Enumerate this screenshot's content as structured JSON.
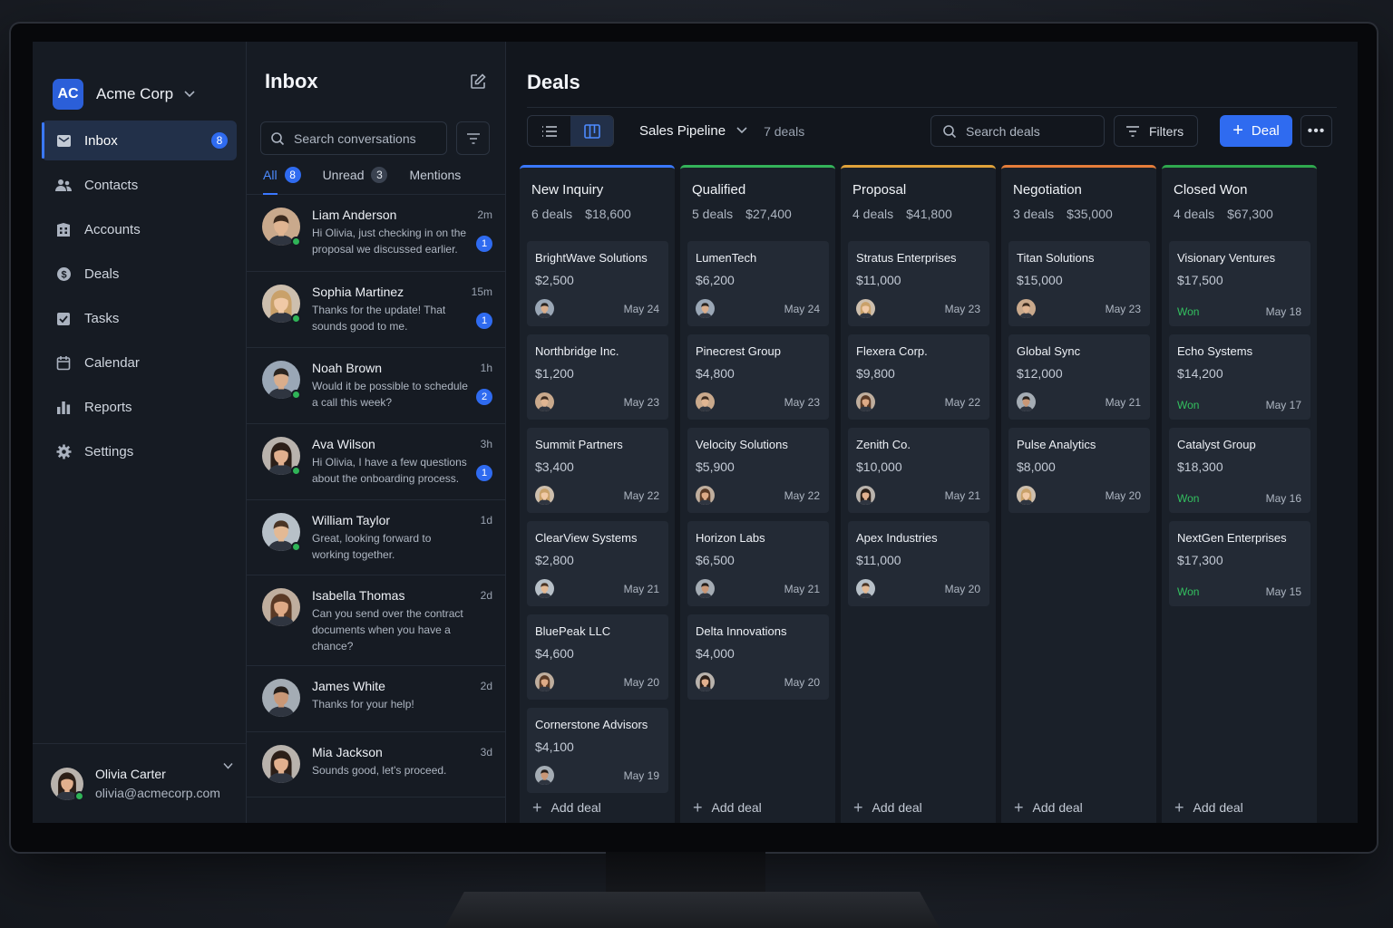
{
  "org": {
    "initials": "AC",
    "name": "Acme Corp"
  },
  "nav": [
    {
      "label": "Inbox",
      "icon": "inbox-icon",
      "badge": "8",
      "active": true
    },
    {
      "label": "Contacts",
      "icon": "contacts-icon"
    },
    {
      "label": "Accounts",
      "icon": "accounts-icon"
    },
    {
      "label": "Deals",
      "icon": "deals-icon"
    },
    {
      "label": "Tasks",
      "icon": "tasks-icon"
    },
    {
      "label": "Calendar",
      "icon": "calendar-icon"
    },
    {
      "label": "Reports",
      "icon": "reports-icon"
    },
    {
      "label": "Settings",
      "icon": "settings-icon"
    }
  ],
  "user": {
    "name": "Olivia Carter",
    "email": "olivia@acmecorp.com"
  },
  "inbox": {
    "title": "Inbox",
    "search_placeholder": "Search conversations",
    "tabs": [
      {
        "label": "All",
        "count": "8",
        "active": true
      },
      {
        "label": "Unread",
        "count": "3"
      },
      {
        "label": "Mentions",
        "count": ""
      }
    ],
    "conversations": [
      {
        "name": "Liam Anderson",
        "time": "2m",
        "message": "Hi Olivia, just checking in on the proposal we discussed earlier.",
        "unread": "1",
        "online": true,
        "avatar": "m1"
      },
      {
        "name": "Sophia Martinez",
        "time": "15m",
        "message": "Thanks for the update! That sounds good to me.",
        "unread": "1",
        "online": true,
        "avatar": "f1"
      },
      {
        "name": "Noah Brown",
        "time": "1h",
        "message": "Would it be possible to schedule a call this week?",
        "unread": "2",
        "online": true,
        "avatar": "m2"
      },
      {
        "name": "Ava Wilson",
        "time": "3h",
        "message": "Hi Olivia, I have a few questions about the onboarding process.",
        "unread": "1",
        "online": true,
        "avatar": "f2"
      },
      {
        "name": "William Taylor",
        "time": "1d",
        "message": "Great, looking forward to working together.",
        "unread": "",
        "online": true,
        "avatar": "m3"
      },
      {
        "name": "Isabella Thomas",
        "time": "2d",
        "message": "Can you send over the contract documents when you have a chance?",
        "unread": "",
        "online": false,
        "avatar": "f3"
      },
      {
        "name": "James White",
        "time": "2d",
        "message": "Thanks for your help!",
        "unread": "",
        "online": false,
        "avatar": "m4"
      },
      {
        "name": "Mia Jackson",
        "time": "3d",
        "message": "Sounds good, let's proceed.",
        "unread": "",
        "online": false,
        "avatar": "f2"
      }
    ]
  },
  "deals": {
    "title": "Deals",
    "pipeline": "Sales Pipeline",
    "deal_count": "7 deals",
    "search_placeholder": "Search deals",
    "filters_label": "Filters",
    "new_label": "Deal",
    "add_label": "Add deal",
    "columns": [
      {
        "name": "New Inquiry",
        "count": "6 deals",
        "total": "$18,600",
        "color": "#3a78ff",
        "cards": [
          {
            "name": "BrightWave Solutions",
            "value": "$2,500",
            "date": "May 24",
            "avatar": "m2"
          },
          {
            "name": "Northbridge Inc.",
            "value": "$1,200",
            "date": "May 23",
            "avatar": "m1"
          },
          {
            "name": "Summit Partners",
            "value": "$3,400",
            "date": "May 22",
            "avatar": "f1"
          },
          {
            "name": "ClearView Systems",
            "value": "$2,800",
            "date": "May 21",
            "avatar": "m3"
          },
          {
            "name": "BluePeak LLC",
            "value": "$4,600",
            "date": "May 20",
            "avatar": "f3"
          },
          {
            "name": "Cornerstone Advisors",
            "value": "$4,100",
            "date": "May 19",
            "avatar": "m4"
          }
        ]
      },
      {
        "name": "Qualified",
        "count": "5 deals",
        "total": "$27,400",
        "color": "#34b35a",
        "cards": [
          {
            "name": "LumenTech",
            "value": "$6,200",
            "date": "May 24",
            "avatar": "m2"
          },
          {
            "name": "Pinecrest Group",
            "value": "$4,800",
            "date": "May 23",
            "avatar": "m1"
          },
          {
            "name": "Velocity Solutions",
            "value": "$5,900",
            "date": "May 22",
            "avatar": "f3"
          },
          {
            "name": "Horizon Labs",
            "value": "$6,500",
            "date": "May 21",
            "avatar": "m4"
          },
          {
            "name": "Delta Innovations",
            "value": "$4,000",
            "date": "May 20",
            "avatar": "f2"
          }
        ]
      },
      {
        "name": "Proposal",
        "count": "4 deals",
        "total": "$41,800",
        "color": "#e0a23a",
        "cards": [
          {
            "name": "Stratus Enterprises",
            "value": "$11,000",
            "date": "May 23",
            "avatar": "f1"
          },
          {
            "name": "Flexera Corp.",
            "value": "$9,800",
            "date": "May 22",
            "avatar": "f3"
          },
          {
            "name": "Zenith Co.",
            "value": "$10,000",
            "date": "May 21",
            "avatar": "f2"
          },
          {
            "name": "Apex Industries",
            "value": "$11,000",
            "date": "May 20",
            "avatar": "m3"
          }
        ]
      },
      {
        "name": "Negotiation",
        "count": "3 deals",
        "total": "$35,000",
        "color": "#e57d3a",
        "cards": [
          {
            "name": "Titan Solutions",
            "value": "$15,000",
            "date": "May 23",
            "avatar": "m1"
          },
          {
            "name": "Global Sync",
            "value": "$12,000",
            "date": "May 21",
            "avatar": "m4"
          },
          {
            "name": "Pulse Analytics",
            "value": "$8,000",
            "date": "May 20",
            "avatar": "f1"
          }
        ]
      },
      {
        "name": "Closed Won",
        "count": "4 deals",
        "total": "$67,300",
        "color": "#2fa84e",
        "cards": [
          {
            "name": "Visionary Ventures",
            "value": "$17,500",
            "date": "May 18",
            "won": "Won"
          },
          {
            "name": "Echo Systems",
            "value": "$14,200",
            "date": "May 17",
            "won": "Won"
          },
          {
            "name": "Catalyst Group",
            "value": "$18,300",
            "date": "May 16",
            "won": "Won"
          },
          {
            "name": "NextGen Enterprises",
            "value": "$17,300",
            "date": "May 15",
            "won": "Won"
          }
        ]
      }
    ]
  }
}
